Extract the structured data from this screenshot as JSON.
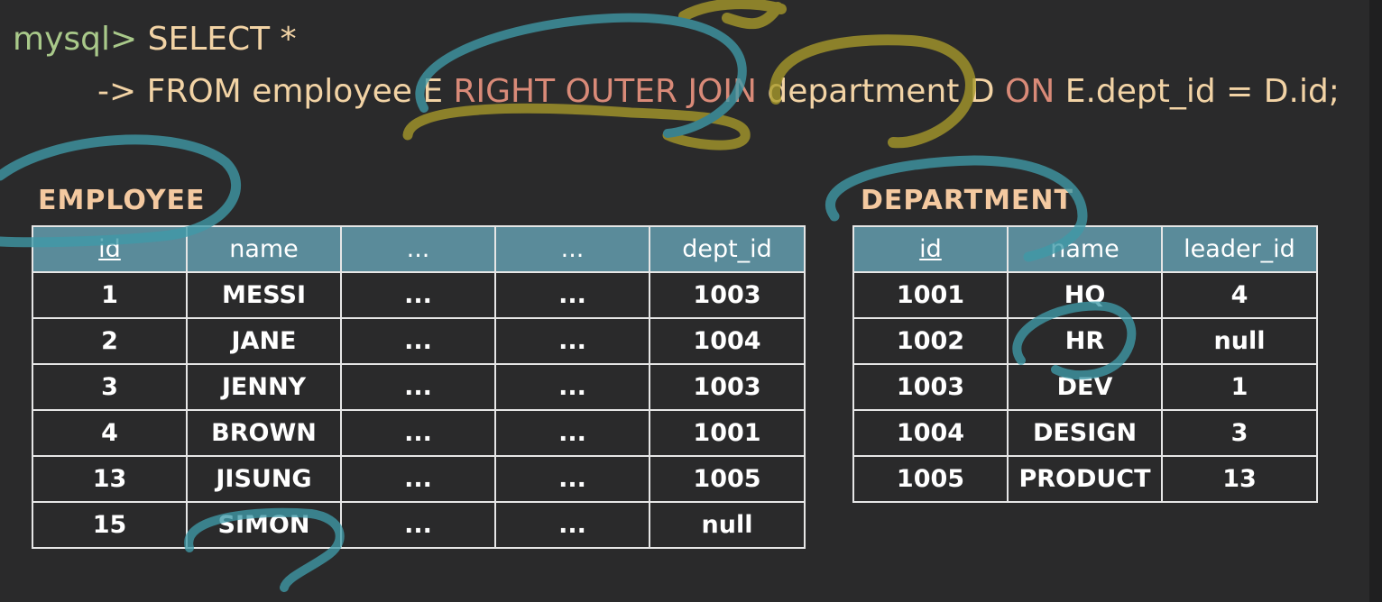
{
  "query": {
    "prompt": "mysql>",
    "line1_rest": " SELECT *",
    "continuation": "->",
    "from_kw": "FROM",
    "employee_alias": "employee E",
    "join_kw": "RIGHT OUTER JOIN",
    "department_alias": "department D",
    "on_kw": "ON",
    "condition": "E.dept_id = D.id;"
  },
  "employee": {
    "title": "EMPLOYEE",
    "columns": [
      "id",
      "name",
      "...",
      "...",
      "dept_id"
    ],
    "rows": [
      [
        "1",
        "MESSI",
        "...",
        "...",
        "1003"
      ],
      [
        "2",
        "JANE",
        "...",
        "...",
        "1004"
      ],
      [
        "3",
        "JENNY",
        "...",
        "...",
        "1003"
      ],
      [
        "4",
        "BROWN",
        "...",
        "...",
        "1001"
      ],
      [
        "13",
        "JISUNG",
        "...",
        "...",
        "1005"
      ],
      [
        "15",
        "SIMON",
        "...",
        "...",
        "null"
      ]
    ]
  },
  "department": {
    "title": "DEPARTMENT",
    "columns": [
      "id",
      "name",
      "leader_id"
    ],
    "rows": [
      [
        "1001",
        "HQ",
        "4"
      ],
      [
        "1002",
        "HR",
        "null"
      ],
      [
        "1003",
        "DEV",
        "1"
      ],
      [
        "1004",
        "DESIGN",
        "3"
      ],
      [
        "1005",
        "PRODUCT",
        "13"
      ]
    ]
  },
  "colors": {
    "background": "#2a2a2b",
    "header_fill": "#5a8b9a",
    "annotation_teal": "#3f9aa8",
    "annotation_olive": "#a89a2a"
  }
}
